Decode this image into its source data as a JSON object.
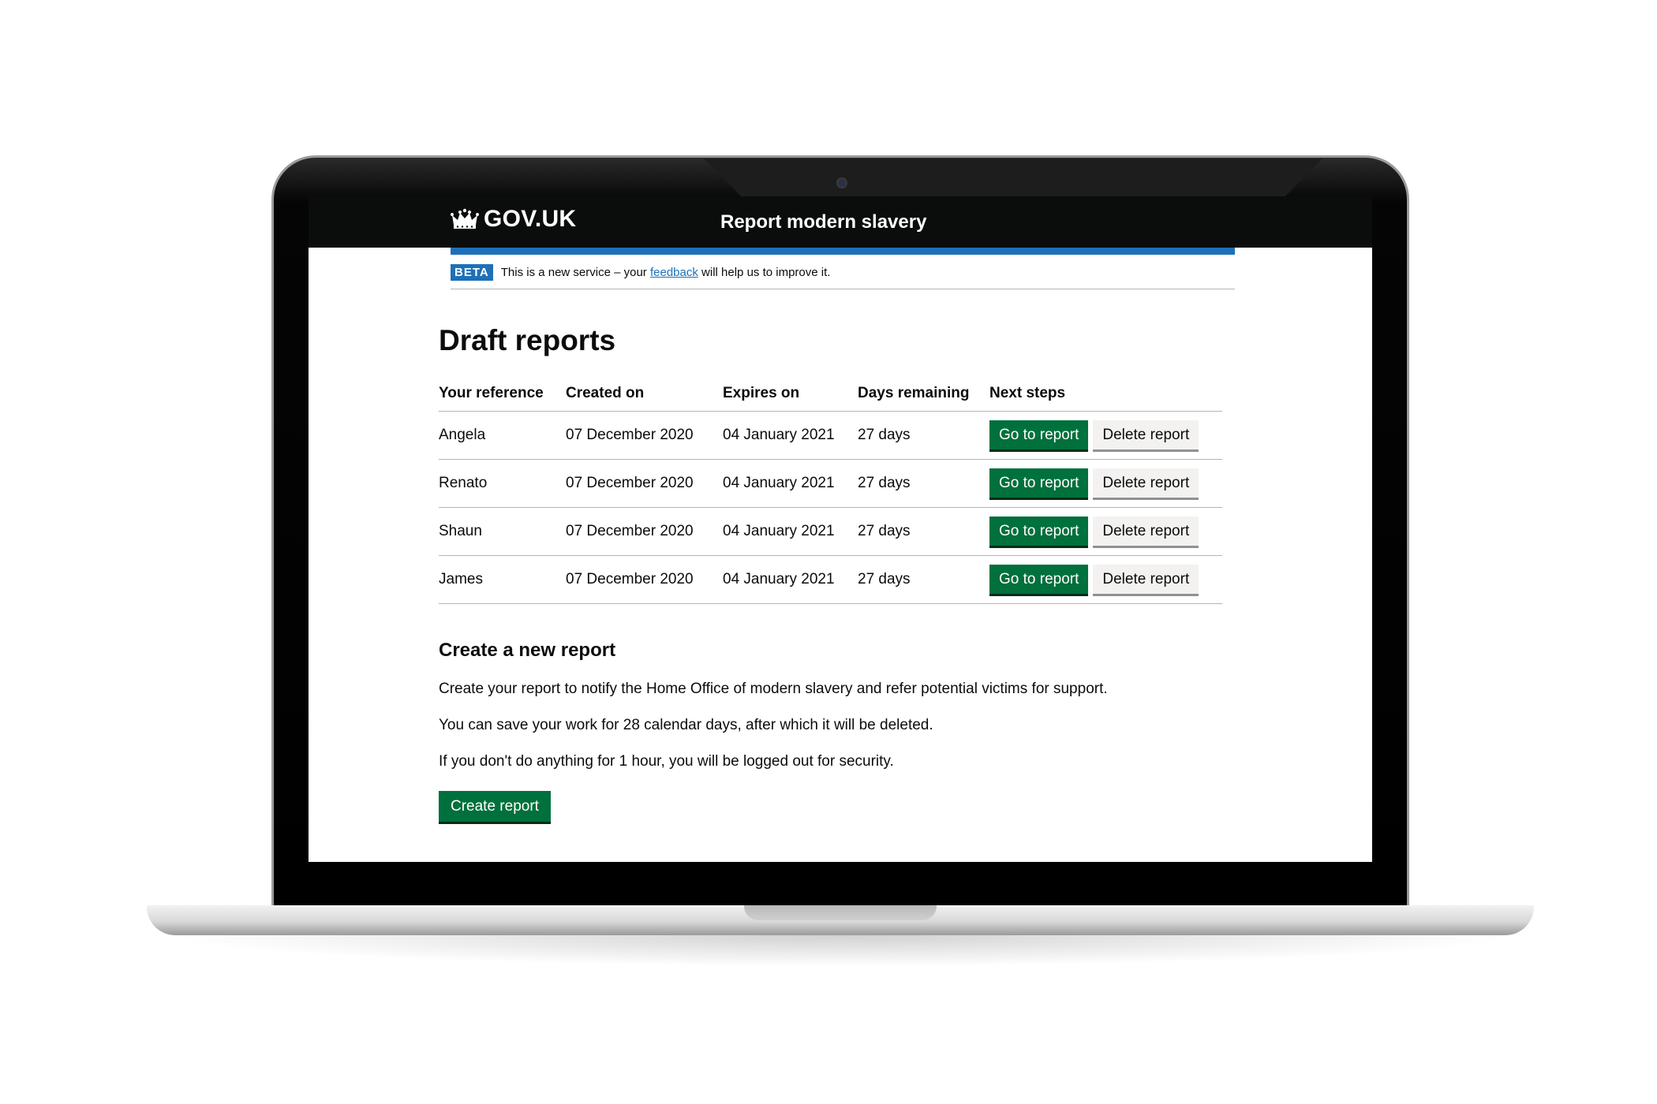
{
  "header": {
    "logo_text": "GOV.UK",
    "service_name": "Report modern slavery"
  },
  "phase_banner": {
    "tag": "BETA",
    "text_before": "This is a new service – your ",
    "link_text": "feedback",
    "text_after": " will help us to improve it."
  },
  "main": {
    "title": "Draft reports",
    "table": {
      "headers": [
        "Your reference",
        "Created on",
        "Expires on",
        "Days remaining",
        "Next steps"
      ],
      "rows": [
        {
          "reference": "Angela",
          "created": "07 December 2020",
          "expires": "04 January 2021",
          "days": "27 days",
          "go_label": "Go to report",
          "delete_label": "Delete report"
        },
        {
          "reference": "Renato",
          "created": "07 December 2020",
          "expires": "04 January 2021",
          "days": "27 days",
          "go_label": "Go to report",
          "delete_label": "Delete report"
        },
        {
          "reference": "Shaun",
          "created": "07 December 2020",
          "expires": "04 January 2021",
          "days": "27 days",
          "go_label": "Go to report",
          "delete_label": "Delete report"
        },
        {
          "reference": "James",
          "created": "07 December 2020",
          "expires": "04 January 2021",
          "days": "27 days",
          "go_label": "Go to report",
          "delete_label": "Delete report"
        }
      ]
    },
    "create_section": {
      "heading": "Create a new report",
      "paragraphs": [
        "Create your report to notify the Home Office of modern slavery and refer potential victims for support.",
        "You can save your work for 28 calendar days, after which it will be deleted.",
        "If you don't do anything for 1 hour, you will be logged out for security."
      ],
      "button_label": "Create report"
    }
  },
  "colors": {
    "header_bg": "#0b0c0c",
    "brand_blue": "#1d70b8",
    "button_green": "#00703c",
    "button_grey": "#f3f2f1"
  },
  "icons": {
    "logo_icon": "crown-icon",
    "device_camera": "camera-icon"
  }
}
